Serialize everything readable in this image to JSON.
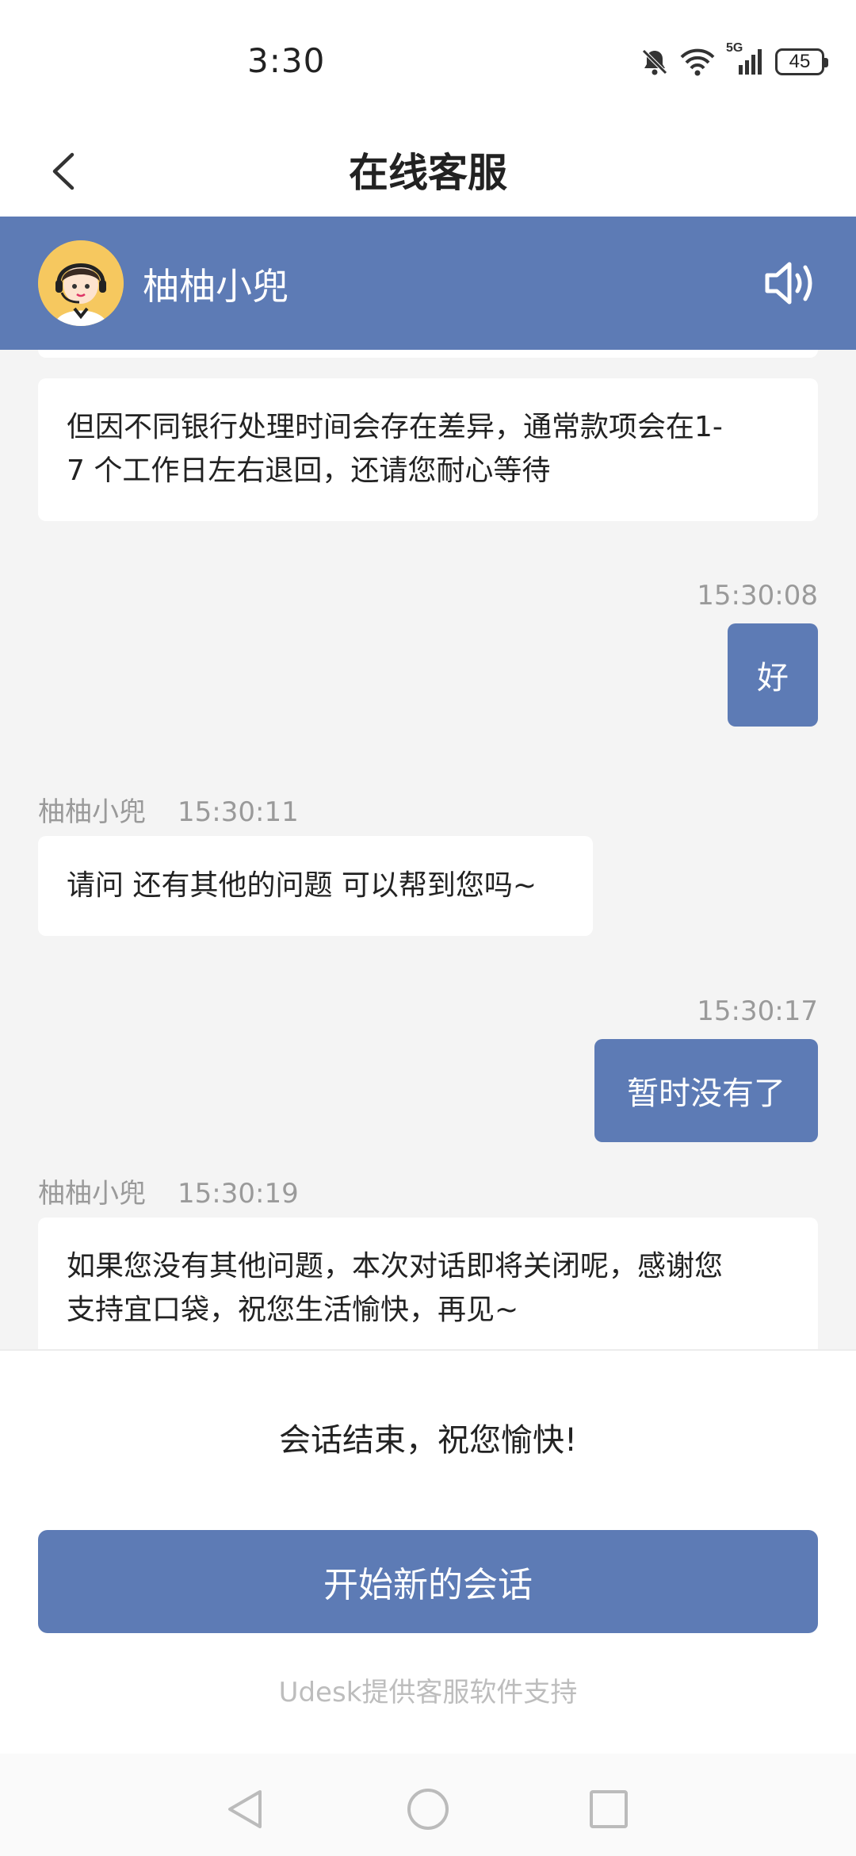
{
  "status_bar": {
    "time": "3:30",
    "network_label": "5G",
    "battery": "45",
    "icons": [
      "mute-bell-icon",
      "wifi-icon",
      "signal-icon",
      "battery-icon"
    ]
  },
  "header": {
    "title": "在线客服",
    "back_icon": "back-chevron-icon"
  },
  "agent": {
    "name": "柚柚小兜",
    "avatar": "support-agent-avatar",
    "speaker_icon": "speaker-icon"
  },
  "messages": [
    {
      "side": "left",
      "text_line1": "但因不同银行处理时间会存在差异，通常款项会在1-",
      "text_line2": "7 个工作日左右退回，还请您耐心等待"
    },
    {
      "side": "right",
      "time": "15:30:08",
      "text": "好"
    },
    {
      "side": "left",
      "sender": "柚柚小兜",
      "time": "15:30:11",
      "text": "请问 还有其他的问题 可以帮到您吗~"
    },
    {
      "side": "right",
      "time": "15:30:17",
      "text": "暂时没有了"
    },
    {
      "side": "left",
      "sender": "柚柚小兜",
      "time": "15:30:19",
      "text_line1": "如果您没有其他问题，本次对话即将关闭呢，感谢您",
      "text_line2": "支持宜口袋，祝您生活愉快，再见~"
    }
  ],
  "bottom": {
    "end_text": "会话结束，祝您愉快!",
    "new_session_button": "开始新的会话",
    "powered_by": "Udesk提供客服软件支持"
  },
  "nav": {
    "icons": [
      "nav-back-icon",
      "nav-home-icon",
      "nav-recents-icon"
    ]
  },
  "colors": {
    "accent": "#5d7bb5",
    "chat_bg": "#f4f4f4",
    "meta_text": "#9a9a9a"
  }
}
